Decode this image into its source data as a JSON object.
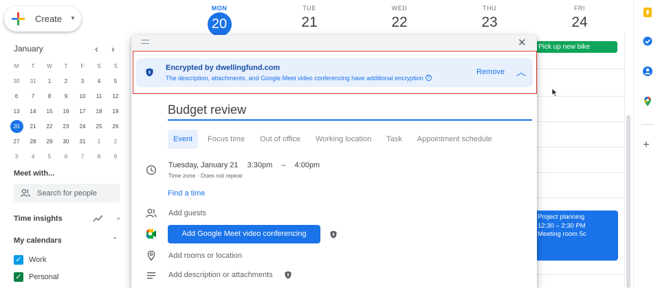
{
  "sidebar": {
    "create_label": "Create",
    "mini_calendar": {
      "month": "January",
      "weekdays": [
        "M",
        "T",
        "W",
        "T",
        "F",
        "S",
        "S"
      ],
      "weeks": [
        [
          "30",
          "31",
          "1",
          "2",
          "3",
          "4",
          "5"
        ],
        [
          "6",
          "7",
          "8",
          "9",
          "10",
          "11",
          "12"
        ],
        [
          "13",
          "14",
          "15",
          "16",
          "17",
          "18",
          "19"
        ],
        [
          "20",
          "21",
          "22",
          "23",
          "24",
          "25",
          "26"
        ],
        [
          "27",
          "28",
          "29",
          "30",
          "31",
          "1",
          "2"
        ],
        [
          "3",
          "4",
          "5",
          "6",
          "7",
          "8",
          "9"
        ]
      ],
      "today": "20"
    },
    "meet_with_title": "Meet with...",
    "search_people_placeholder": "Search for people",
    "time_insights_title": "Time insights",
    "my_calendars_title": "My calendars",
    "calendars": [
      {
        "name": "Work",
        "color": "#039be5"
      },
      {
        "name": "Personal",
        "color": "#0b8043"
      }
    ]
  },
  "week_header": [
    {
      "dow": "MON",
      "date": "20",
      "active": true
    },
    {
      "dow": "TUE",
      "date": "21",
      "active": false
    },
    {
      "dow": "WED",
      "date": "22",
      "active": false
    },
    {
      "dow": "THU",
      "date": "23",
      "active": false
    },
    {
      "dow": "FRI",
      "date": "24",
      "active": false
    }
  ],
  "events": {
    "bike": {
      "title": "Pick up new bike",
      "color": "#0fa55a"
    },
    "project": {
      "title": "Project planning",
      "time": "12:30 – 2:30 PM",
      "location": "Meeting room 5c",
      "color": "#1a73e8"
    }
  },
  "dialog": {
    "encryption": {
      "title": "Encrypted by dwellingfund.com",
      "description": "The description, attachments, and Google Meet video conferencing have additional encryption",
      "remove_label": "Remove"
    },
    "title_value": "Budget review",
    "tabs": [
      "Event",
      "Focus time",
      "Out of office",
      "Working location",
      "Task",
      "Appointment schedule"
    ],
    "date": "Tuesday, January 21",
    "start_time": "3:30pm",
    "dash": "–",
    "end_time": "4:00pm",
    "timezone_line": "Time zone · Does not repeat",
    "find_time_label": "Find a time",
    "guests_placeholder": "Add guests",
    "meet_button_label": "Add Google Meet video conferencing",
    "rooms_placeholder": "Add rooms or location",
    "description_placeholder": "Add description or attachments"
  },
  "colors": {
    "accent": "#1a73e8",
    "highlight_outline": "#d93025"
  }
}
